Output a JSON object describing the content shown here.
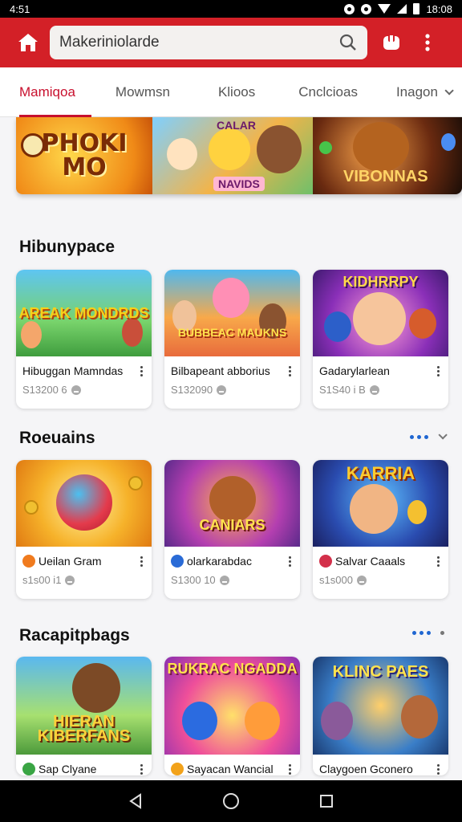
{
  "status": {
    "time": "4:51",
    "clock": "18:08"
  },
  "search": {
    "value": "Makeriniolarde"
  },
  "tabs": [
    {
      "label": "Mamiqoa",
      "active": true
    },
    {
      "label": "Mowmsn"
    },
    {
      "label": "Klioos"
    },
    {
      "label": "Cnclcioas"
    },
    {
      "label": "Inagon"
    }
  ],
  "banner": {
    "seg1": "PHOKI MO",
    "seg2_top": "CALAR",
    "seg2_bottom": "NAVIDS",
    "seg3": "VIBONNAS"
  },
  "sections": [
    {
      "title": "Hibunypace",
      "cards": [
        {
          "art": "AREAK MONDRDS",
          "title": "Hibuggan Mamndas",
          "meta": "S13200 6"
        },
        {
          "art": "BUBBEAC MAUKNS",
          "title": "Bilbapeant abborius",
          "meta": "S132090"
        },
        {
          "art": "KIDHRRPY",
          "title": "Gadarylarlean",
          "meta": "S1S40 i B"
        }
      ]
    },
    {
      "title": "Roeuains",
      "cards": [
        {
          "art": "",
          "title": "Ueilan Gram",
          "meta": "s1s00 i1"
        },
        {
          "art": "CANIARS",
          "title": "olarkarabdac",
          "meta": "S1300 10"
        },
        {
          "art": "KARRIA",
          "title": "Salvar Caaals",
          "meta": "s1s000"
        }
      ]
    },
    {
      "title": "Racapitpbags",
      "cards": [
        {
          "art": "HIERAN KIBERFANS",
          "title": "Sap Clyane",
          "meta": ""
        },
        {
          "art": "RUKRAC NGADDA",
          "title": "Sayacan Wancial",
          "meta": ""
        },
        {
          "art": "KLINC PAES",
          "title": "Claygoen Gconero",
          "meta": ""
        }
      ]
    }
  ],
  "colors": {
    "app_bar": "#d32027",
    "active_tab": "#c8102e",
    "section_dots": "#1f66d1"
  }
}
